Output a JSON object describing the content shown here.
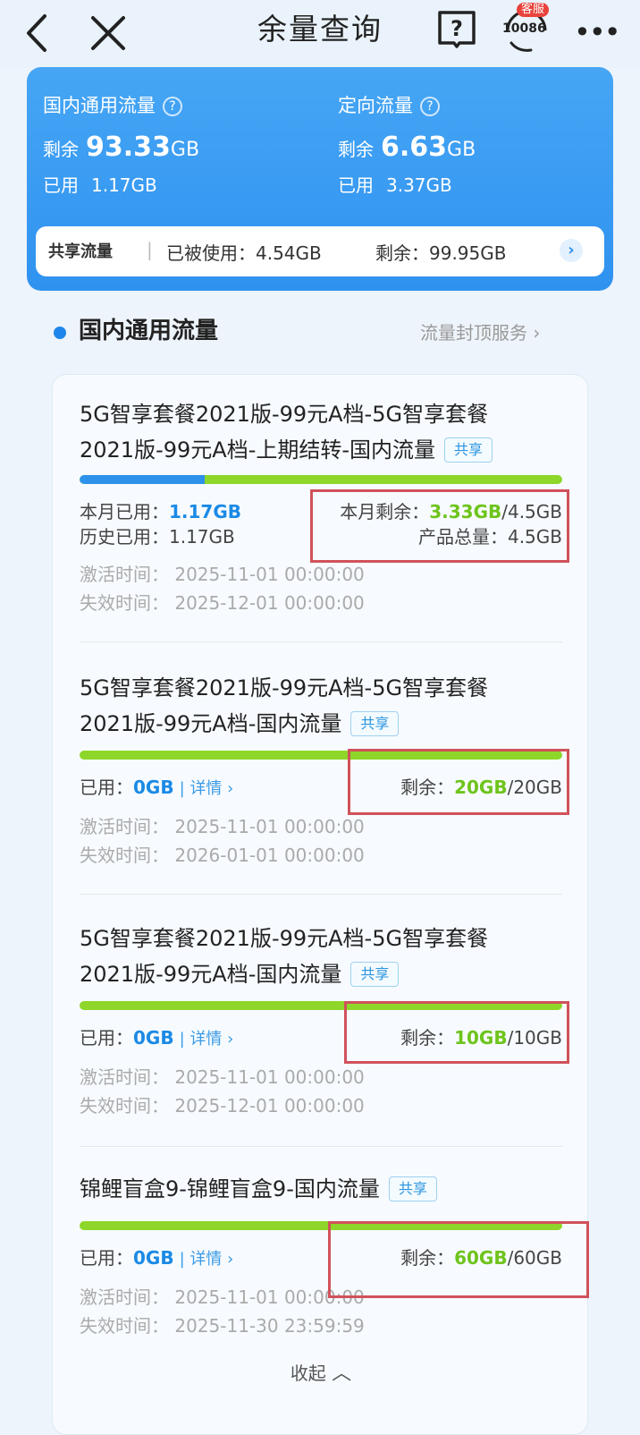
{
  "header": {
    "title": "余量查询",
    "cs_badge": "客服",
    "cs_number": "10086",
    "more": "•••"
  },
  "summary": {
    "domestic": {
      "title": "国内通用流量",
      "remain_label": "剩余",
      "remain_value": "93.33",
      "remain_unit": "GB",
      "used_label": "已用",
      "used_value": "1.17GB"
    },
    "directed": {
      "title": "定向流量",
      "remain_label": "剩余",
      "remain_value": "6.63",
      "remain_unit": "GB",
      "used_label": "已用",
      "used_value": "3.37GB"
    },
    "share": {
      "label": "共享流量",
      "sep": "|",
      "used_text": "已被使用：4.54GB",
      "remain_text": "剩余：99.95GB",
      "arrow": "›"
    }
  },
  "section": {
    "title": "国内通用流量",
    "link": "流量封顶服务 ›"
  },
  "items": [
    {
      "name_line1": "5G智享套餐2021版-99元A档-5G智享套餐",
      "name_line2": "2021版-99元A档-上期结转-国内流量",
      "tag": "共享",
      "used_fraction": 0.26,
      "month_used_label": "本月已用：",
      "month_used_value": "1.17GB",
      "history_used_label": "历史已用：",
      "history_used_value": "1.17GB",
      "month_remain_label": "本月剩余：",
      "month_remain_value": "3.33GB",
      "month_remain_total": "/4.5GB",
      "product_total_label": "产品总量：",
      "product_total_value": "4.5GB",
      "activate": "激活时间：  2025-11-01 00:00:00",
      "expire": "失效时间：  2025-12-01 00:00:00"
    },
    {
      "name_line1": "5G智享套餐2021版-99元A档-5G智享套餐",
      "name_line2": "2021版-99元A档-国内流量",
      "tag": "共享",
      "used_fraction": 0,
      "used_label": "已用：",
      "used_value": "0GB",
      "detail": "| 详情 ›",
      "remain_label": "剩余：",
      "remain_value": "20GB",
      "remain_total": "/20GB",
      "activate": "激活时间：  2025-11-01 00:00:00",
      "expire": "失效时间：  2026-01-01 00:00:00"
    },
    {
      "name_line1": "5G智享套餐2021版-99元A档-5G智享套餐",
      "name_line2": "2021版-99元A档-国内流量",
      "tag": "共享",
      "used_fraction": 0,
      "used_label": "已用：",
      "used_value": "0GB",
      "detail": "| 详情 ›",
      "remain_label": "剩余：",
      "remain_value": "10GB",
      "remain_total": "/10GB",
      "activate": "激活时间：  2025-11-01 00:00:00",
      "expire": "失效时间：  2025-12-01 00:00:00"
    },
    {
      "name_line1": "锦鲤盲盒9-锦鲤盲盒9-国内流量",
      "tag": "共享",
      "used_fraction": 0,
      "used_label": "已用：",
      "used_value": "0GB",
      "detail": "| 详情 ›",
      "remain_label": "剩余：",
      "remain_value": "60GB",
      "remain_total": "/60GB",
      "activate": "激活时间：  2025-11-01 00:00:00",
      "expire": "失效时间：  2025-11-30 23:59:59"
    }
  ],
  "collapse": "收起",
  "colors": {
    "primary": "#2f92ef",
    "green": "#8ed629",
    "red_box": "#d0525a"
  }
}
